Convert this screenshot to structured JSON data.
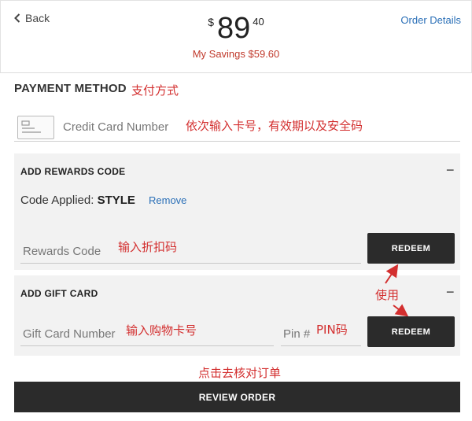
{
  "header": {
    "back_label": "Back",
    "currency": "$",
    "price_int": "89",
    "price_cents": "40",
    "savings": "My Savings $59.60",
    "order_details": "Order Details"
  },
  "payment": {
    "title": "PAYMENT METHOD",
    "title_annotation": "支付方式",
    "cc_placeholder": "Credit Card Number",
    "cc_annotation": "依次输入卡号，有效期以及安全码"
  },
  "rewards": {
    "title": "ADD REWARDS CODE",
    "collapse": "−",
    "applied_label": "Code Applied:",
    "applied_code": "STYLE",
    "remove": "Remove",
    "code_placeholder": "Rewards Code",
    "code_annotation": "输入折扣码",
    "redeem": "REDEEM"
  },
  "gift": {
    "title": "ADD GIFT CARD",
    "collapse": "−",
    "use_annotation": "使用",
    "card_placeholder": "Gift Card Number",
    "card_annotation": "输入购物卡号",
    "pin_placeholder": "Pin #",
    "pin_annotation": "PIN码",
    "redeem": "REDEEM"
  },
  "review": {
    "annotation": "点击去核对订单",
    "button": "REVIEW ORDER"
  },
  "colors": {
    "annotation_red": "#d32f2f",
    "link_blue": "#2a6fb7",
    "button_dark": "#2b2b2b"
  }
}
